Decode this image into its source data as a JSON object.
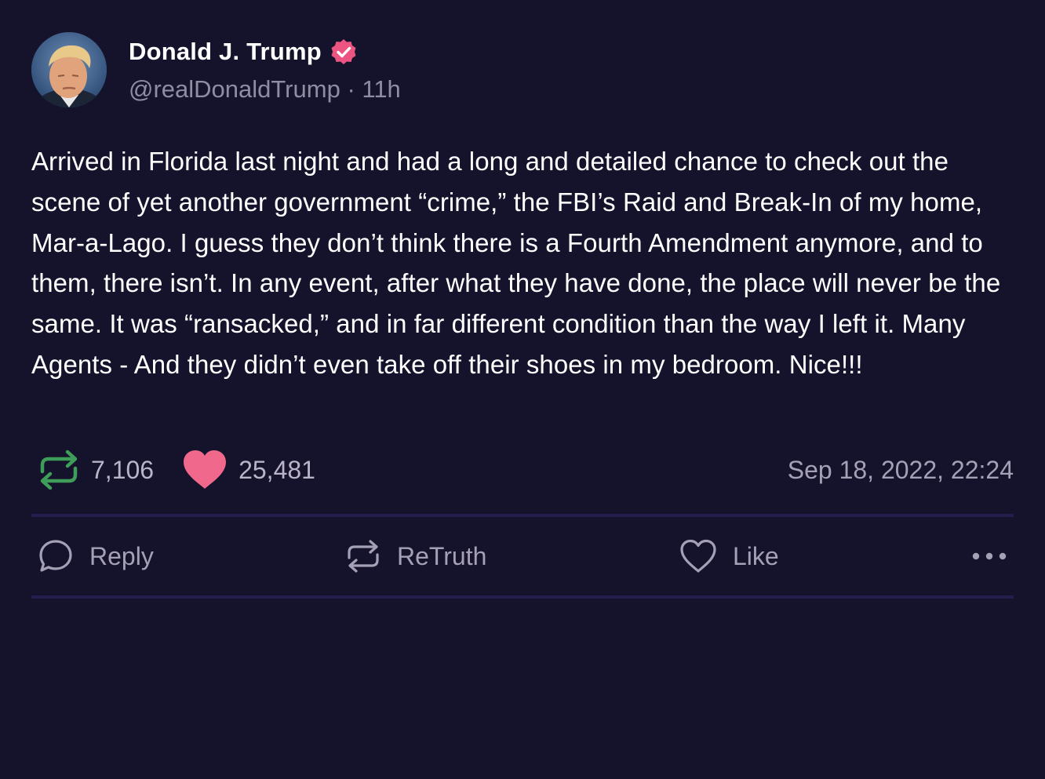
{
  "author": {
    "display_name": "Donald J. Trump",
    "handle": "@realDonaldTrump",
    "separator": "·",
    "time_ago": "11h",
    "verified": true
  },
  "post": {
    "text": "Arrived in Florida last night and had a long and detailed chance to check out the scene of yet another government “crime,” the FBI’s Raid and Break-In of my home, Mar-a-Lago. I guess they don’t think there is a Fourth Amendment anymore, and to them, there isn’t. In any event, after what they have done, the place will never be the same. It was “ransacked,” and in far different condition than the way I left it. Many Agents - And they didn’t even take off their shoes in my bedroom. Nice!!!"
  },
  "stats": {
    "retruths": "7,106",
    "likes": "25,481",
    "timestamp": "Sep 18, 2022, 22:24"
  },
  "actions": {
    "reply": "Reply",
    "retruth": "ReTruth",
    "like": "Like",
    "more_icon": "ellipsis-icon"
  },
  "colors": {
    "background": "#15122b",
    "retruth_green": "#3f9d5a",
    "like_pink": "#f0698d",
    "verified_badge": "#ec5582",
    "muted_text": "#8f8ca3",
    "divider": "#231e4c"
  }
}
